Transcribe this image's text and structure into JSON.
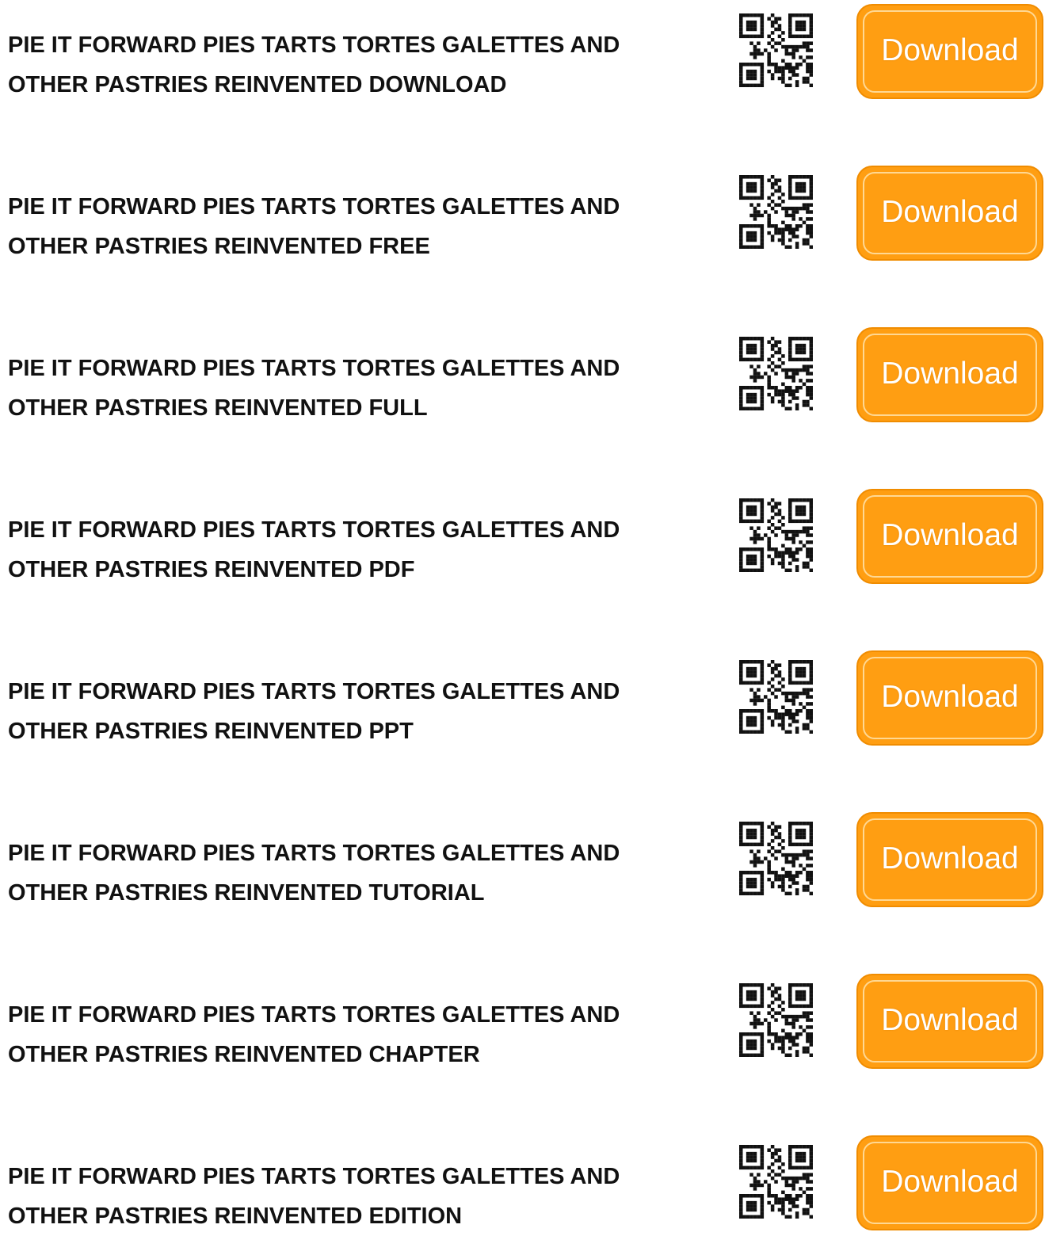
{
  "rows": [
    {
      "title": "PIE IT FORWARD PIES TARTS TORTES GALETTES AND OTHER PASTRIES REINVENTED DOWNLOAD",
      "button_label": "Download"
    },
    {
      "title": "PIE IT FORWARD PIES TARTS TORTES GALETTES AND OTHER PASTRIES REINVENTED FREE",
      "button_label": "Download"
    },
    {
      "title": "PIE IT FORWARD PIES TARTS TORTES GALETTES AND OTHER PASTRIES REINVENTED FULL",
      "button_label": "Download"
    },
    {
      "title": "PIE IT FORWARD PIES TARTS TORTES GALETTES AND OTHER PASTRIES REINVENTED PDF",
      "button_label": "Download"
    },
    {
      "title": "PIE IT FORWARD PIES TARTS TORTES GALETTES AND OTHER PASTRIES REINVENTED PPT",
      "button_label": "Download"
    },
    {
      "title": "PIE IT FORWARD PIES TARTS TORTES GALETTES AND OTHER PASTRIES REINVENTED TUTORIAL",
      "button_label": "Download"
    },
    {
      "title": "PIE IT FORWARD PIES TARTS TORTES GALETTES AND OTHER PASTRIES REINVENTED CHAPTER",
      "button_label": "Download"
    },
    {
      "title": "PIE IT FORWARD PIES TARTS TORTES GALETTES AND OTHER PASTRIES REINVENTED EDITION",
      "button_label": "Download"
    }
  ],
  "icons": {
    "qr": "qr-code-icon"
  },
  "colors": {
    "button_fill": "#ff9e12",
    "button_border": "#f08c00",
    "button_text": "#ffffff",
    "title_text": "#111111"
  }
}
